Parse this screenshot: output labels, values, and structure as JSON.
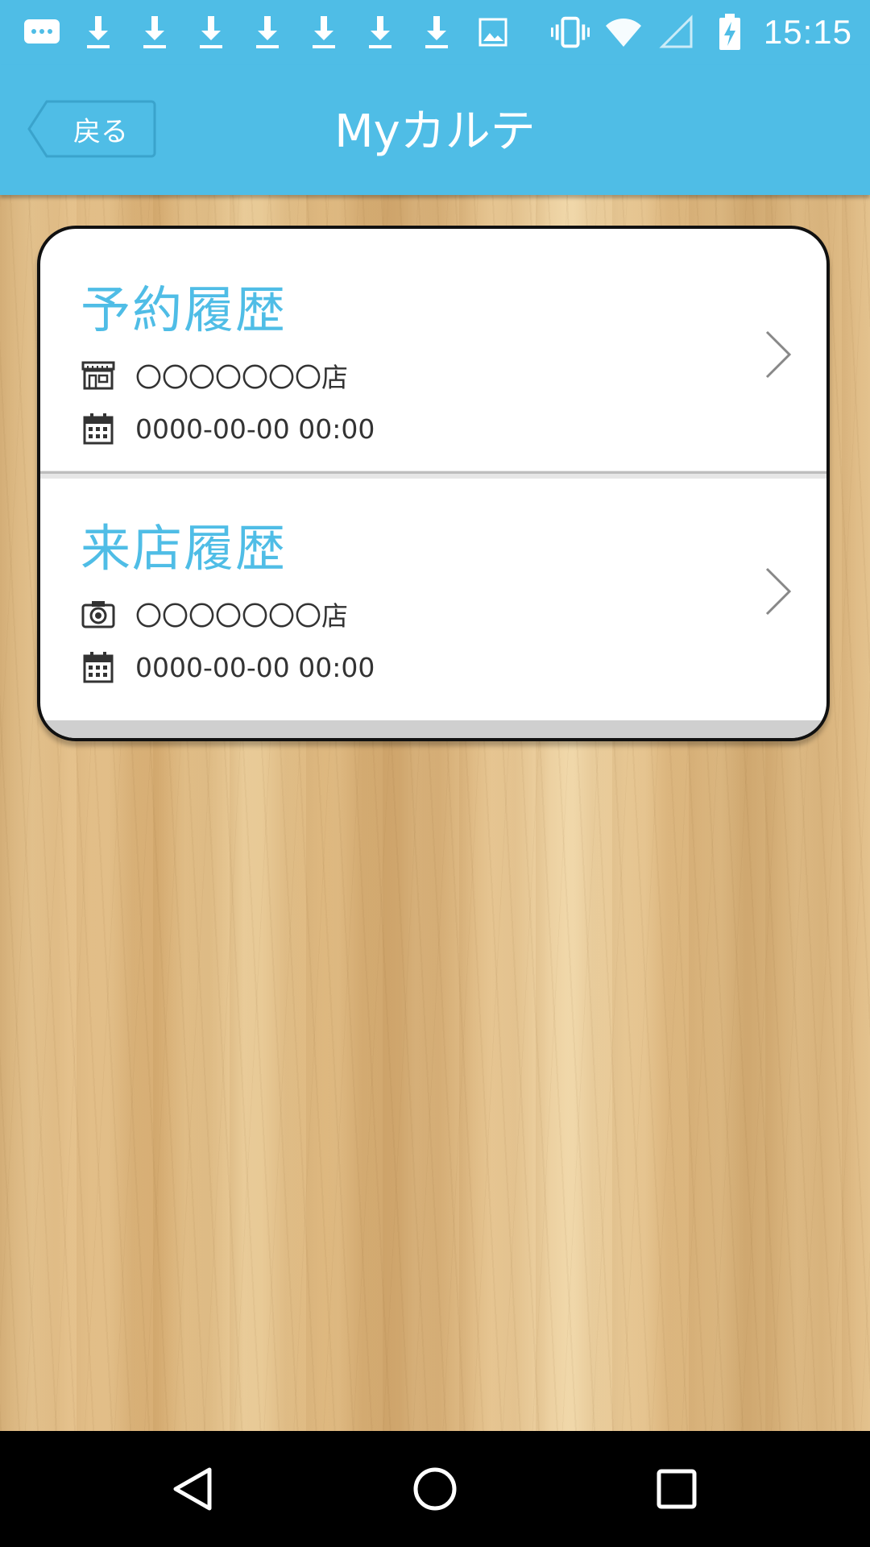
{
  "status_bar": {
    "time": "15:15",
    "left_icons": [
      "message-icon",
      "download-icon",
      "download-icon",
      "download-icon",
      "download-icon",
      "download-icon",
      "download-icon",
      "download-icon",
      "image-icon"
    ],
    "right_icons": [
      "vibrate-icon",
      "wifi-icon",
      "signal-icon",
      "battery-charging-icon"
    ]
  },
  "header": {
    "back_label": "戻る",
    "title": "Myカルテ"
  },
  "card": {
    "reservation": {
      "title": "予約履歴",
      "store_icon": "store-icon",
      "store_text": "〇〇〇〇〇〇〇店",
      "date_icon": "calendar-icon",
      "date_text": "0000-00-00 00:00"
    },
    "visit": {
      "title": "来店履歴",
      "store_icon": "camera-icon",
      "store_text": "〇〇〇〇〇〇〇店",
      "date_icon": "calendar-icon",
      "date_text": "0000-00-00 00:00"
    }
  },
  "navigation_bar": {
    "buttons": [
      "back-icon",
      "home-icon",
      "recents-icon"
    ]
  },
  "colors": {
    "accent": "#4fbde6",
    "nav_background": "#000000"
  }
}
